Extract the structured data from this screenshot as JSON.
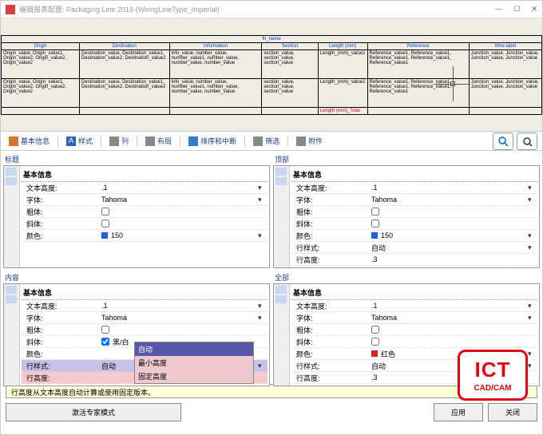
{
  "window": {
    "title": "编辑报表配置: Packaging Line 2019 (WiringLineType_Imperial)"
  },
  "winbtns": {
    "min": "—",
    "max": "☐",
    "close": "✕"
  },
  "preview_headers": [
    "Origin",
    "Destination",
    "Information",
    "Section",
    "Length (mm)",
    "Reference",
    "Wire label"
  ],
  "preview_body": [
    "Origin_value, Origin_value1, Origin_value2, Origin_value2, Origin_value2",
    "Destination_value, Destination_value1, Destination_value2, Destination_value2",
    "info_value, number_value, number_value1, number_value, number_value, number_value",
    "section_value, section_value, section_value",
    "Length_(mm)_value1",
    "Reference_value1, Reference_value1, Reference_value1, Reference_value1, Reference_value1",
    "Junction_value, Junction_value, Junction_value, Junction_value"
  ],
  "total_label": "Length (mm)_Total",
  "toolbar": {
    "basic": "基本信息",
    "style": "样式",
    "col": "列",
    "layout": "布局",
    "sort": "排序和中断",
    "filter": "筛选",
    "attach": "附件"
  },
  "panels": {
    "p1": {
      "title": "标题",
      "section": "基本信息",
      "rows": {
        "textHeight": {
          "l": "文本高度:",
          "v": ".1"
        },
        "font": {
          "l": "字体:",
          "v": "Tahoma"
        },
        "bold": {
          "l": "粗体:"
        },
        "italic": {
          "l": "斜体:"
        },
        "color": {
          "l": "颜色:",
          "v": "150",
          "sw": "#2060e0"
        }
      }
    },
    "p2": {
      "title": "顶部",
      "section": "基本信息",
      "rows": {
        "textHeight": {
          "l": "文本高度:",
          "v": ".1"
        },
        "font": {
          "l": "字体:",
          "v": "Tahoma"
        },
        "bold": {
          "l": "粗体:"
        },
        "italic": {
          "l": "斜体:"
        },
        "color": {
          "l": "颜色:",
          "v": "150",
          "sw": "#2060e0"
        },
        "rowStyle": {
          "l": "行样式:",
          "v": "自动"
        },
        "rowHeight": {
          "l": "行高度:",
          "v": ".3"
        }
      }
    },
    "p3": {
      "title": "内容",
      "section": "基本信息",
      "rows": {
        "textHeight": {
          "l": "文本高度:",
          "v": ".1"
        },
        "font": {
          "l": "字体:",
          "v": "Tahoma"
        },
        "bold": {
          "l": "粗体:"
        },
        "italic": {
          "l": "斜体:",
          "extra": "黑/白"
        },
        "color": {
          "l": "颜色:"
        },
        "rowStyle": {
          "l": "行样式:",
          "v": "自动",
          "hl": true
        },
        "rowHeight": {
          "l": "行高度:"
        }
      },
      "dropdown": [
        "自动",
        "最小高度",
        "固定高度"
      ]
    },
    "p4": {
      "title": "全部",
      "section": "基本信息",
      "rows": {
        "textHeight": {
          "l": "文本高度:",
          "v": ".1"
        },
        "font": {
          "l": "字体:",
          "v": "Tahoma"
        },
        "bold": {
          "l": "粗体:"
        },
        "italic": {
          "l": "斜体:"
        },
        "color": {
          "l": "颜色:",
          "v": "红色",
          "sw": "#e02020"
        },
        "rowStyle": {
          "l": "行样式:",
          "v": "自动"
        },
        "rowHeight": {
          "l": "行高度:",
          "v": ".3"
        }
      }
    }
  },
  "status": "行高度从文本高度自动计算或使用固定版本。",
  "footer": {
    "expert": "激活专家模式",
    "apply": "应用",
    "close": "关闭"
  },
  "logo": {
    "t1": "ICT",
    "t2": "CAD/CAM"
  }
}
